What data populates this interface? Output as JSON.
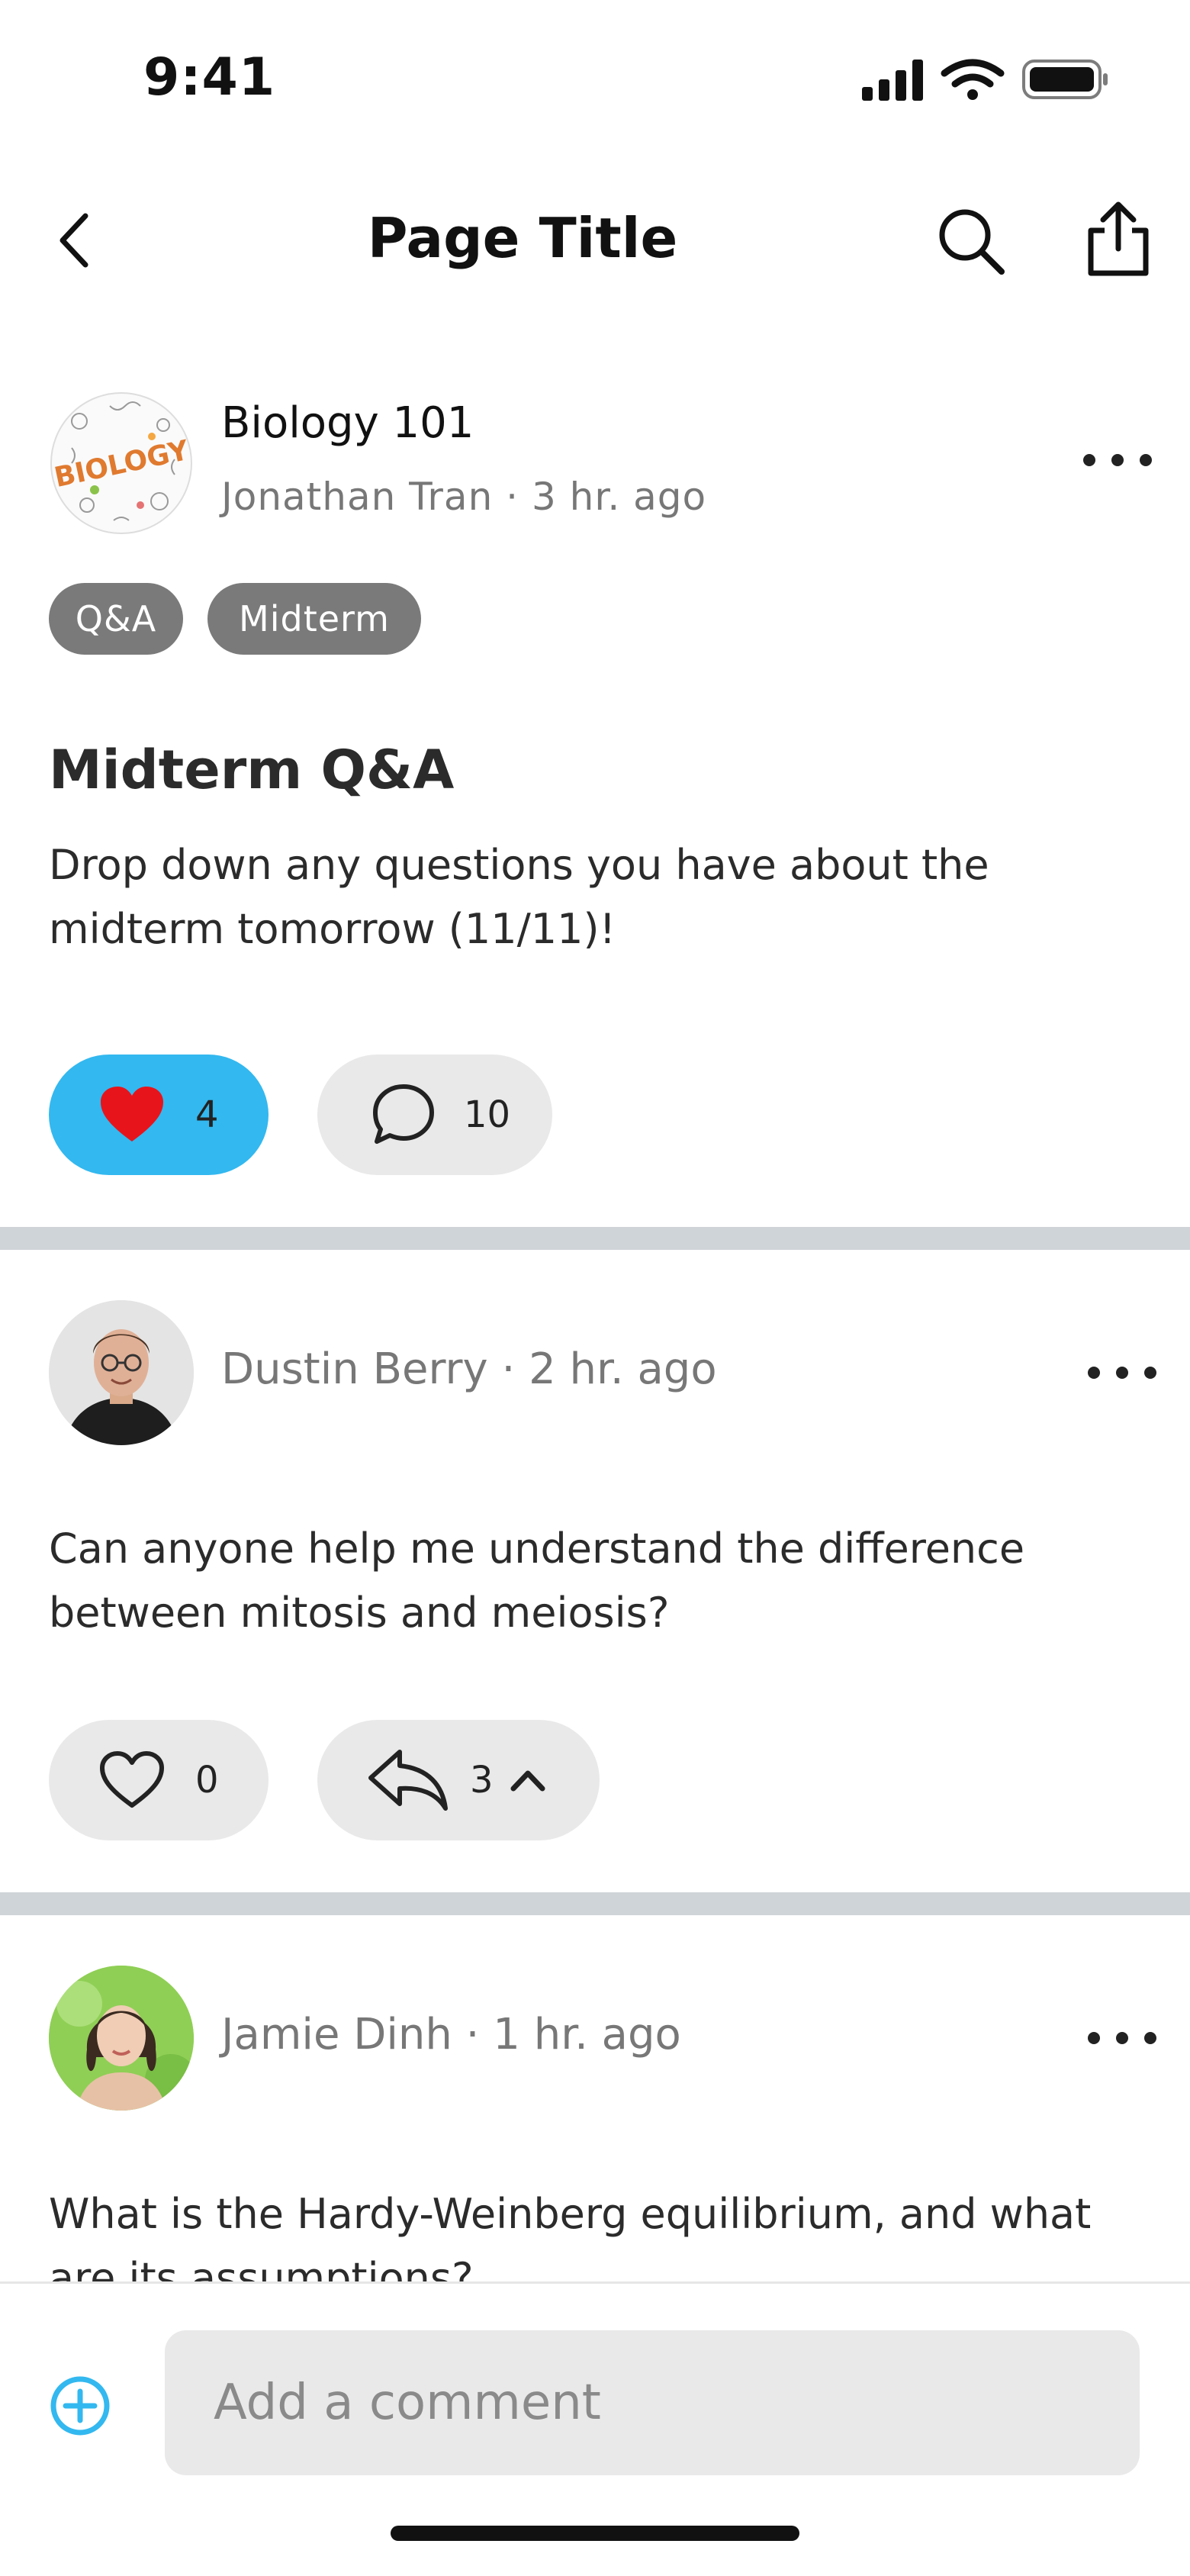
{
  "status_bar": {
    "time": "9:41"
  },
  "nav": {
    "title": "Page Title"
  },
  "post": {
    "course": "Biology 101",
    "course_logo_text": "BIOLOGY",
    "author": "Jonathan Tran",
    "time": "3 hr. ago",
    "tags": [
      "Q&A",
      "Midterm"
    ],
    "title": "Midterm Q&A",
    "body": "Drop down any questions you have about the midterm tomorrow (11/11)!",
    "likes": "4",
    "comments": "10",
    "liked": true
  },
  "comments": [
    {
      "author": "Dustin Berry",
      "time": "2 hr. ago",
      "body": "Can anyone help me understand the difference between mitosis and meiosis?",
      "likes": "0",
      "replies": "3"
    },
    {
      "author": "Jamie Dinh",
      "time": "1 hr. ago",
      "body": "What is the Hardy-Weinberg equilibrium, and what are its assumptions?"
    }
  ],
  "meta_separator": " · ",
  "composer": {
    "placeholder": "Add a comment"
  },
  "colors": {
    "accent": "#33b8ef",
    "heart": "#e8141b",
    "divider": "#cfd4d8",
    "tag": "#7a7a7a"
  }
}
